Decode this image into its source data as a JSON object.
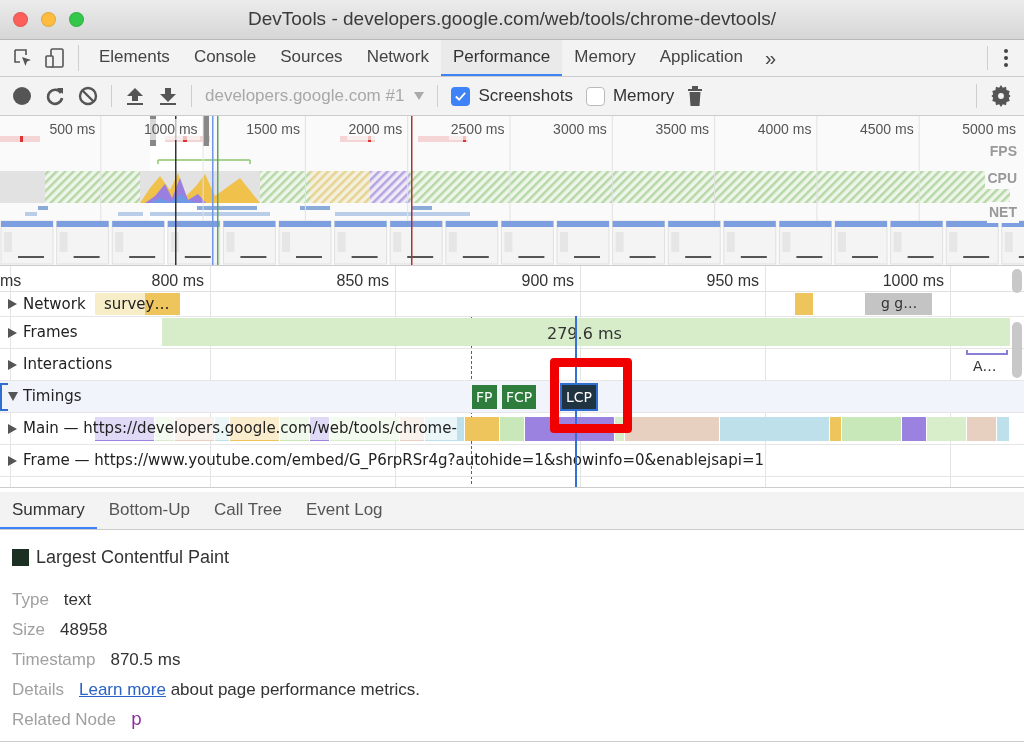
{
  "window": {
    "title": "DevTools - developers.google.com/web/tools/chrome-devtools/"
  },
  "tabs": [
    {
      "label": "Elements",
      "selected": false
    },
    {
      "label": "Console",
      "selected": false
    },
    {
      "label": "Sources",
      "selected": false
    },
    {
      "label": "Network",
      "selected": false
    },
    {
      "label": "Performance",
      "selected": true
    },
    {
      "label": "Memory",
      "selected": false
    },
    {
      "label": "Application",
      "selected": false
    }
  ],
  "tabs_overflow": "»",
  "toolbar": {
    "target": "developers.google.com #1",
    "target_disabled": true,
    "checkboxes": [
      {
        "label": "Screenshots",
        "checked": true
      },
      {
        "label": "Memory",
        "checked": false
      }
    ]
  },
  "overview": {
    "ticks": [
      "500 ms",
      "1000 ms",
      "1500 ms",
      "2000 ms",
      "2500 ms",
      "3000 ms",
      "3500 ms",
      "4000 ms",
      "4500 ms",
      "5000 ms"
    ],
    "lanes": [
      "FPS",
      "CPU",
      "NET"
    ]
  },
  "flame": {
    "ticks": [
      "ms",
      "800 ms",
      "850 ms",
      "900 ms",
      "950 ms",
      "1000 ms"
    ],
    "tracks": [
      {
        "kind": "network",
        "label": "Network",
        "expanded": false,
        "events": [
          {
            "label": "survey…"
          },
          {
            "label": "g g…"
          }
        ]
      },
      {
        "kind": "frames",
        "label": "Frames",
        "expanded": false,
        "events": [
          {
            "label": "279.6 ms"
          }
        ]
      },
      {
        "kind": "interactions",
        "label": "Interactions",
        "expanded": false,
        "events": [
          {
            "label": "A…"
          }
        ]
      },
      {
        "kind": "timings",
        "label": "Timings",
        "expanded": true,
        "markers": [
          {
            "label": "FP",
            "selected": false
          },
          {
            "label": "FCP",
            "selected": false
          },
          {
            "label": "LCP",
            "selected": true
          }
        ]
      },
      {
        "kind": "main",
        "label": "Main — https://developers.google.com/web/tools/chrome-",
        "expanded": false
      },
      {
        "kind": "frame",
        "label": "Frame — https://www.youtube.com/embed/G_P6rpRSr4g?autohide=1&showinfo=0&enablejsapi=1",
        "expanded": false
      }
    ]
  },
  "detail_tabs": [
    {
      "label": "Summary",
      "selected": true
    },
    {
      "label": "Bottom-Up",
      "selected": false
    },
    {
      "label": "Call Tree",
      "selected": false
    },
    {
      "label": "Event Log",
      "selected": false
    }
  ],
  "summary": {
    "title": "Largest Contentful Paint",
    "color": "#1b3022",
    "rows": [
      {
        "kind": "text",
        "label": "Type",
        "value": "text"
      },
      {
        "kind": "text",
        "label": "Size",
        "value": "48958"
      },
      {
        "kind": "text",
        "label": "Timestamp",
        "value": "870.5 ms"
      },
      {
        "kind": "link",
        "label": "Details",
        "link": "Learn more",
        "value": "about page performance metrics."
      },
      {
        "kind": "node",
        "label": "Related Node",
        "value": "p"
      }
    ]
  }
}
